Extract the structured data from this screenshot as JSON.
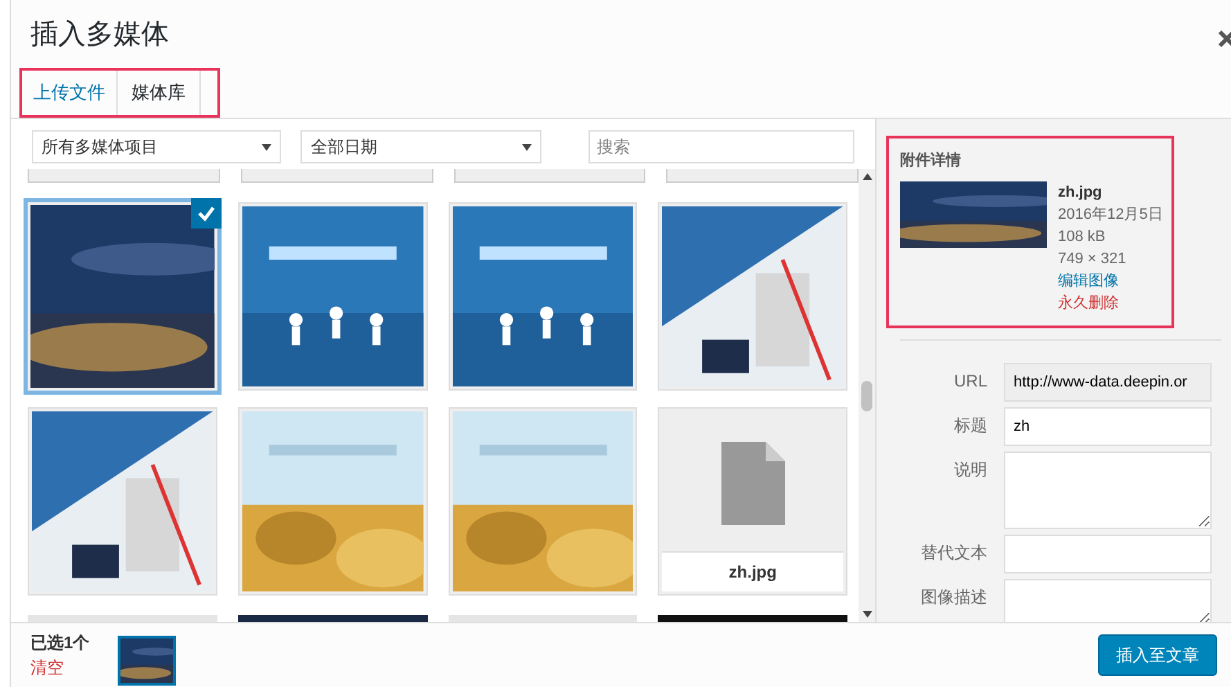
{
  "title": "插入多媒体",
  "tabs": [
    {
      "label": "上传文件",
      "selected": true
    },
    {
      "label": "媒体库",
      "selected": false
    }
  ],
  "filters": [
    {
      "kind": "select",
      "value": "所有多媒体项目"
    },
    {
      "kind": "select",
      "value": "全部日期"
    },
    {
      "kind": "search",
      "placeholder": "搜索"
    }
  ],
  "grid": [
    {
      "kind": "picture",
      "selected": true
    },
    {
      "kind": "picture",
      "selected": false
    },
    {
      "kind": "picture",
      "selected": false
    },
    {
      "kind": "picture",
      "selected": false
    },
    {
      "kind": "picture",
      "selected": false
    },
    {
      "kind": "picture",
      "selected": false
    },
    {
      "kind": "picture",
      "selected": false
    },
    {
      "kind": "file",
      "selected": false,
      "filename": "zh.jpg"
    }
  ],
  "details": {
    "heading": "附件详情",
    "filename": "zh.jpg",
    "date": "2016年12月5日",
    "size": "108 kB",
    "dimensions": "749 × 321",
    "edit_link": "编辑图像",
    "delete_link": "永久删除"
  },
  "fields": [
    {
      "label": "URL",
      "value": "http://www-data.deepin.or",
      "kind": "readonly"
    },
    {
      "label": "标题",
      "value": "zh",
      "kind": "text"
    },
    {
      "label": "说明",
      "kind": "textarea"
    },
    {
      "label": "替代文本",
      "kind": "text"
    },
    {
      "label": "图像描述",
      "kind": "textarea"
    }
  ],
  "footer": {
    "selected_count": "已选1个",
    "clear_link": "清空",
    "insert_button": "插入至文章"
  }
}
